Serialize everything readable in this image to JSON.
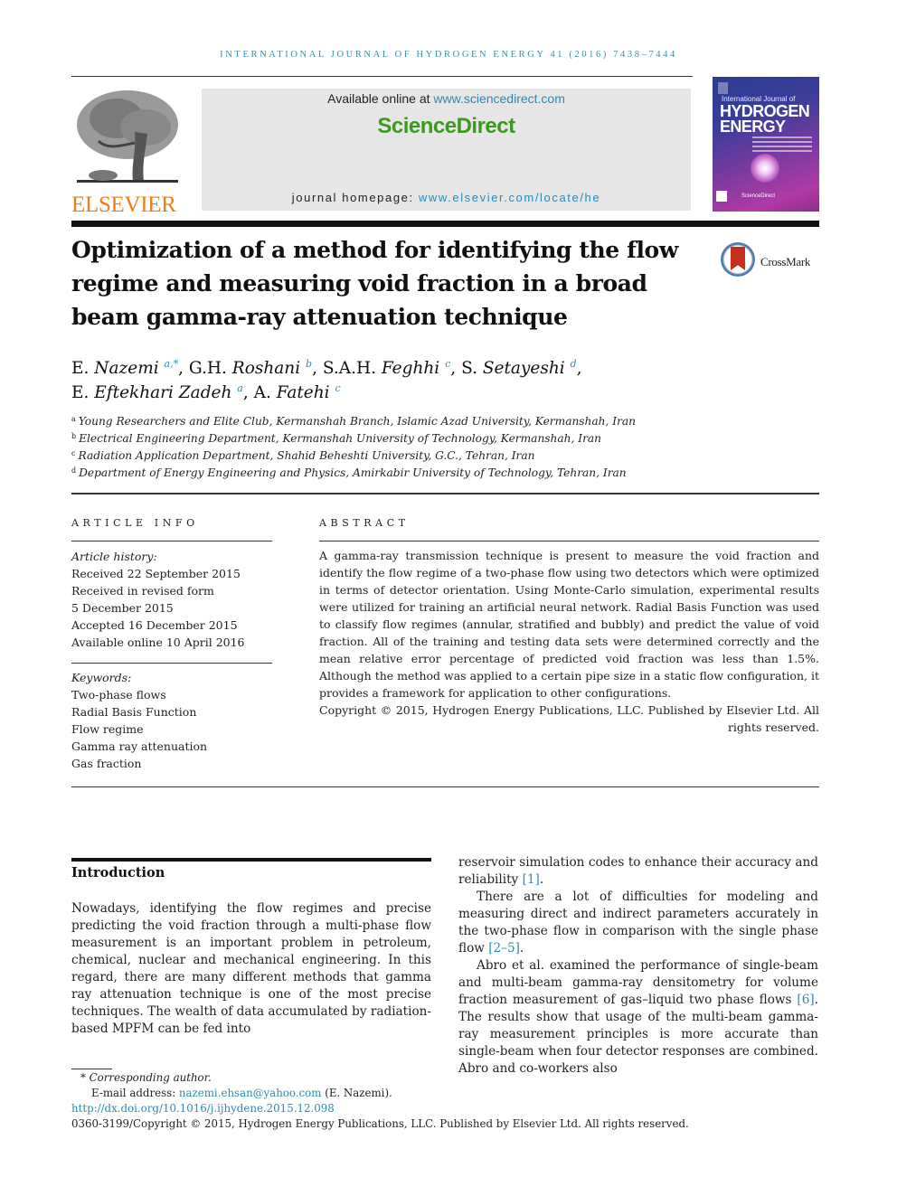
{
  "running_header": "INTERNATIONAL JOURNAL OF HYDROGEN ENERGY 41 (2016) 7438–7444",
  "publisher": {
    "logo_text": "ELSEVIER",
    "brand_color": "#ef7d12"
  },
  "banner": {
    "available_prefix": "Available online at",
    "available_link": "www.sciencedirect.com",
    "sciencedirect_logo": "ScienceDirect",
    "sciencedirect_color": "#3a9a1e",
    "homepage_prefix": "journal homepage:",
    "homepage_link": "www.elsevier.com/locate/he",
    "link_color": "#2a8bb5"
  },
  "cover": {
    "top_text": "International Journal of",
    "title_line1": "HYDROGEN",
    "title_line2": "ENERGY",
    "footer_text": "ScienceDirect"
  },
  "article": {
    "title": "Optimization of a method for identifying the flow regime and measuring void fraction in a broad beam gamma-ray attenuation technique",
    "crossmark_label": "CrossMark",
    "authors": [
      {
        "name": "E. Nazemi",
        "affil": "a,*"
      },
      {
        "name": "G.H. Roshani",
        "affil": "b"
      },
      {
        "name": "S.A.H. Feghhi",
        "affil": "c"
      },
      {
        "name": "S. Setayeshi",
        "affil": "d"
      },
      {
        "name": "E. Eftekhari Zadeh",
        "affil": "a"
      },
      {
        "name": "A. Fatehi",
        "affil": "c"
      }
    ],
    "affiliations": [
      {
        "key": "a",
        "text": "Young Researchers and Elite Club, Kermanshah Branch, Islamic Azad University, Kermanshah, Iran"
      },
      {
        "key": "b",
        "text": "Electrical Engineering Department, Kermanshah University of Technology, Kermanshah, Iran"
      },
      {
        "key": "c",
        "text": "Radiation Application Department, Shahid Beheshti University, G.C., Tehran, Iran"
      },
      {
        "key": "d",
        "text": "Department of Energy Engineering and Physics, Amirkabir University of Technology, Tehran, Iran"
      }
    ]
  },
  "article_info": {
    "heading": "ARTICLE INFO",
    "history_label": "Article history:",
    "history": [
      "Received 22 September 2015",
      "Received in revised form",
      "5 December 2015",
      "Accepted 16 December 2015",
      "Available online 10 April 2016"
    ],
    "keywords_label": "Keywords:",
    "keywords": [
      "Two-phase flows",
      "Radial Basis Function",
      "Flow regime",
      "Gamma ray attenuation",
      "Gas fraction"
    ]
  },
  "abstract": {
    "heading": "ABSTRACT",
    "text": "A gamma-ray transmission technique is present to measure the void fraction and identify the flow regime of a two-phase flow using two detectors which were optimized in terms of detector orientation. Using Monte-Carlo simulation, experimental results were utilized for training an artificial neural network. Radial Basis Function was used to classify flow re­gimes (annular, stratified and bubbly) and predict the value of void fraction. All of the training and testing data sets were determined correctly and the mean relative error per­centage of predicted void fraction was less than 1.5%. Although the method was applied to a certain pipe size in a static flow configuration, it provides a framework for application to other configurations.",
    "copyright": "Copyright © 2015, Hydrogen Energy Publications, LLC. Published by Elsevier Ltd. All rights reserved."
  },
  "body": {
    "intro_heading": "Introduction",
    "left_para": "Nowadays, identifying the flow regimes and precise predict­ing the void fraction through a multi-phase flow measure­ment is an important problem in petroleum, chemical, nuclear and mechanical engineering. In this regard, there are many different methods that gamma ray attenuation tech­nique is one of the most precise techniques. The wealth of data accumulated by radiation-based MPFM can be fed into",
    "right_p1_text": "reservoir simulation codes to enhance their accuracy and reliability",
    "right_p1_ref": "[1]",
    "right_p2_text": "There are a lot of difficulties for modeling and measuring direct and indirect parameters accurately in the two-phase flow in comparison with the single phase flow",
    "right_p2_ref": "[2–5]",
    "right_p3_text_a": "Abro et al. examined the performance of single-beam and multi-beam gamma-ray densitometry for volume fraction measurement of gas–liquid two phase flows",
    "right_p3_ref": "[6]",
    "right_p3_text_b": ". The results show that usage of the multi-beam gamma-ray measurement principles is more accurate than single-beam when four de­tector responses are combined. Abro and co-workers also"
  },
  "footnotes": {
    "corresponding_label": "Corresponding author.",
    "email_label": "E-mail address:",
    "email": "nazemi.ehsan@yahoo.com",
    "email_owner": "(E. Nazemi).",
    "doi": "http://dx.doi.org/10.1016/j.ijhydene.2015.12.098",
    "issn_copyright": "0360-3199/Copyright © 2015, Hydrogen Energy Publications, LLC. Published by Elsevier Ltd. All rights reserved."
  }
}
